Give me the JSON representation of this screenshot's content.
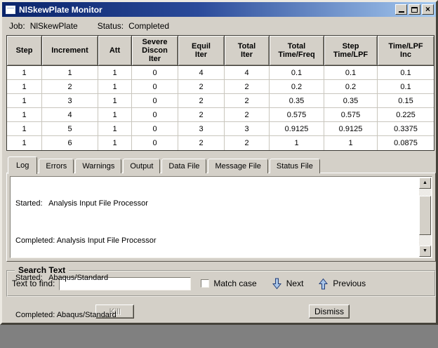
{
  "window": {
    "title": "NlSkewPlate Monitor"
  },
  "job_status": {
    "job_label": "Job:",
    "job_value": "NlSkewPlate",
    "status_label": "Status:",
    "status_value": "Completed"
  },
  "table": {
    "columns": [
      "Step",
      "Increment",
      "Att",
      "Severe\nDiscon\nIter",
      "Equil\nIter",
      "Total\nIter",
      "Total\nTime/Freq",
      "Step\nTime/LPF",
      "Time/LPF\nInc"
    ],
    "rows": [
      [
        "1",
        "1",
        "1",
        "0",
        "4",
        "4",
        "0.1",
        "0.1",
        "0.1"
      ],
      [
        "1",
        "2",
        "1",
        "0",
        "2",
        "2",
        "0.2",
        "0.2",
        "0.1"
      ],
      [
        "1",
        "3",
        "1",
        "0",
        "2",
        "2",
        "0.35",
        "0.35",
        "0.15"
      ],
      [
        "1",
        "4",
        "1",
        "0",
        "2",
        "2",
        "0.575",
        "0.575",
        "0.225"
      ],
      [
        "1",
        "5",
        "1",
        "0",
        "3",
        "3",
        "0.9125",
        "0.9125",
        "0.3375"
      ],
      [
        "1",
        "6",
        "1",
        "0",
        "2",
        "2",
        "1",
        "1",
        "0.0875"
      ]
    ]
  },
  "tabs": [
    {
      "label": "Log",
      "active": true
    },
    {
      "label": "Errors",
      "active": false
    },
    {
      "label": "Warnings",
      "active": false
    },
    {
      "label": "Output",
      "active": false
    },
    {
      "label": "Data File",
      "active": false
    },
    {
      "label": "Message File",
      "active": false
    },
    {
      "label": "Status File",
      "active": false
    }
  ],
  "log": {
    "lines": [
      "Started:   Analysis Input File Processor",
      "Completed: Analysis Input File Processor",
      "Started:   Abaqus/Standard",
      "Completed: Abaqus/Standard"
    ]
  },
  "search": {
    "group_label": "Search Text",
    "find_label": "Text to find:",
    "find_value": "",
    "match_case_label": "Match case",
    "match_case_checked": false,
    "next_label": "Next",
    "previous_label": "Previous"
  },
  "actions": {
    "kill_label": "Kill",
    "kill_enabled": false,
    "dismiss_label": "Dismiss"
  },
  "icons": {
    "close_glyph": "×",
    "scroll_up_glyph": "▲",
    "scroll_down_glyph": "▼"
  },
  "colors": {
    "dialog_bg": "#d4d0c8",
    "titlebar_gradient_start": "#0a246a",
    "titlebar_gradient_end": "#a6caf0",
    "titlebar_text": "#ffffff",
    "arrow_fill": "#aac6e8",
    "arrow_outline": "#1f3c78",
    "table_grid": "#c9c6bd",
    "table_border": "#3c3a34"
  }
}
